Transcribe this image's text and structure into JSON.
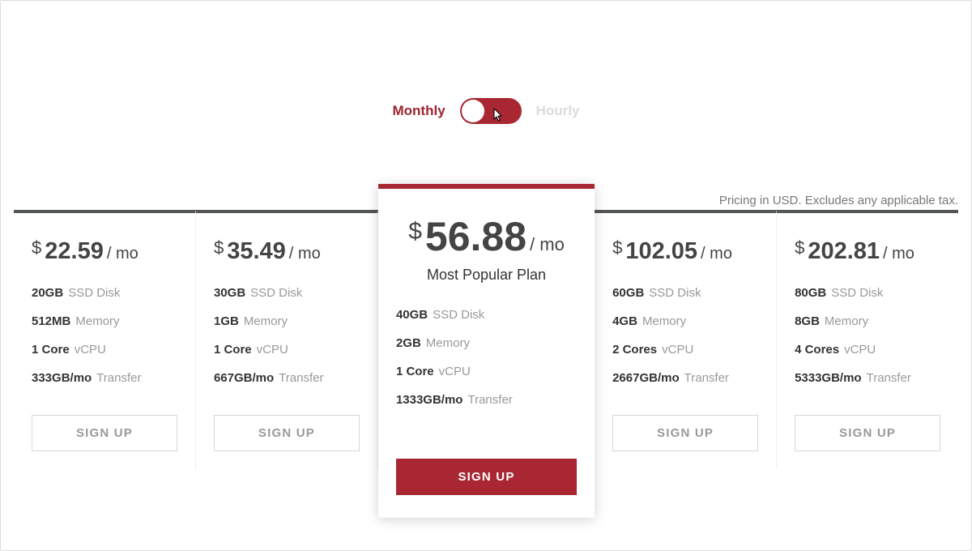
{
  "toggle": {
    "left_label": "Monthly",
    "right_label": "Hourly"
  },
  "disclaimer": "Pricing in USD. Excludes any applicable tax.",
  "currency_symbol": "$",
  "signup_label": "SIGN UP",
  "popular_label": "Most Popular Plan",
  "plans": [
    {
      "amount": "22.59",
      "period": "/ mo",
      "specs": [
        {
          "val": "20GB",
          "label": "SSD Disk"
        },
        {
          "val": "512MB",
          "label": "Memory"
        },
        {
          "val": "1 Core",
          "label": "vCPU"
        },
        {
          "val": "333GB/mo",
          "label": "Transfer"
        }
      ]
    },
    {
      "amount": "35.49",
      "period": "/ mo",
      "specs": [
        {
          "val": "30GB",
          "label": "SSD Disk"
        },
        {
          "val": "1GB",
          "label": "Memory"
        },
        {
          "val": "1 Core",
          "label": "vCPU"
        },
        {
          "val": "667GB/mo",
          "label": "Transfer"
        }
      ]
    },
    {
      "amount": "56.88",
      "period": "/ mo",
      "specs": [
        {
          "val": "40GB",
          "label": "SSD Disk"
        },
        {
          "val": "2GB",
          "label": "Memory"
        },
        {
          "val": "1 Core",
          "label": "vCPU"
        },
        {
          "val": "1333GB/mo",
          "label": "Transfer"
        }
      ]
    },
    {
      "amount": "102.05",
      "period": "/ mo",
      "specs": [
        {
          "val": "60GB",
          "label": "SSD Disk"
        },
        {
          "val": "4GB",
          "label": "Memory"
        },
        {
          "val": "2 Cores",
          "label": "vCPU"
        },
        {
          "val": "2667GB/mo",
          "label": "Transfer"
        }
      ]
    },
    {
      "amount": "202.81",
      "period": "/ mo",
      "specs": [
        {
          "val": "80GB",
          "label": "SSD Disk"
        },
        {
          "val": "8GB",
          "label": "Memory"
        },
        {
          "val": "4 Cores",
          "label": "vCPU"
        },
        {
          "val": "5333GB/mo",
          "label": "Transfer"
        }
      ]
    }
  ]
}
